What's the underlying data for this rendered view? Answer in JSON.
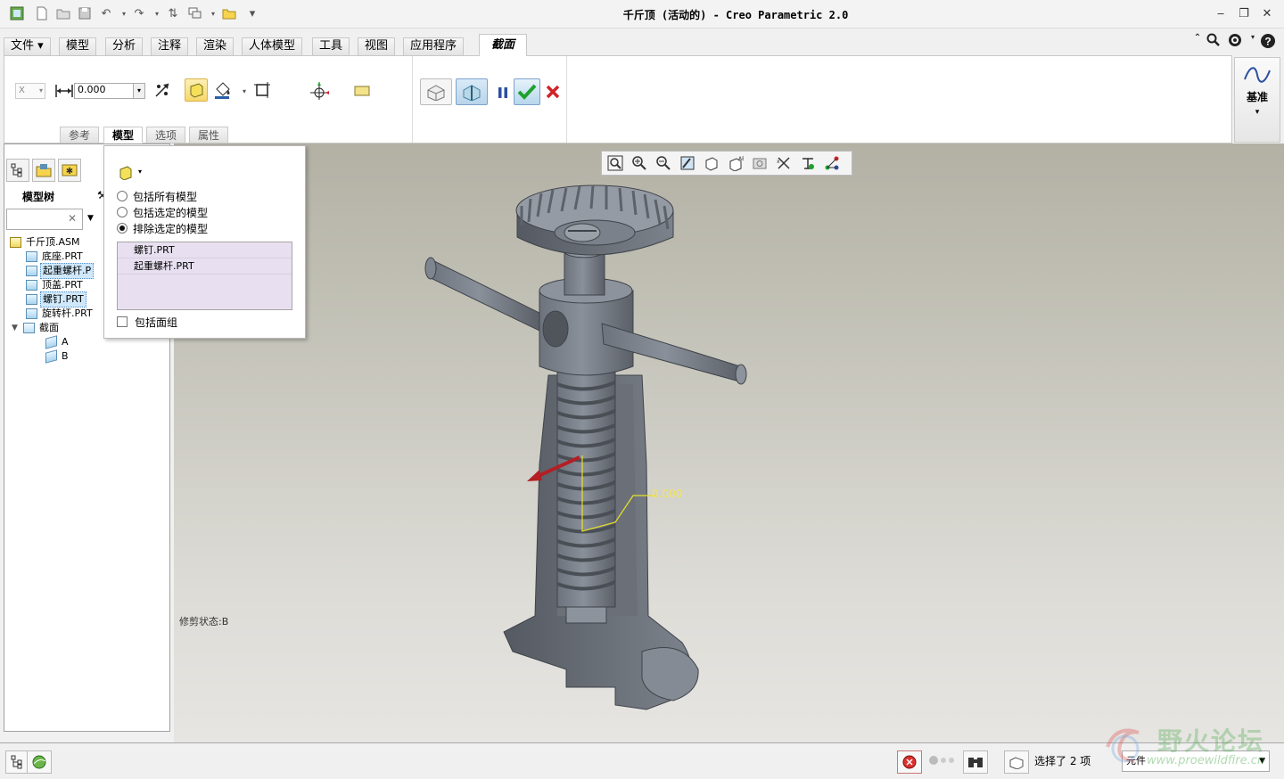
{
  "window": {
    "title": "千斤顶 (活动的) - Creo Parametric 2.0",
    "minimize": "‒",
    "restore": "❐",
    "close": "✕"
  },
  "menu_tabs": [
    {
      "label": "文件 ▾",
      "active": false
    },
    {
      "label": "模型",
      "active": false
    },
    {
      "label": "分析",
      "active": false
    },
    {
      "label": "注释",
      "active": false
    },
    {
      "label": "渲染",
      "active": false
    },
    {
      "label": "人体模型",
      "active": false
    },
    {
      "label": "工具",
      "active": false
    },
    {
      "label": "视图",
      "active": false
    },
    {
      "label": "应用程序",
      "active": false
    },
    {
      "label": "截面",
      "active": true
    }
  ],
  "ribbon": {
    "axis_value": "X",
    "offset_value": "0.000",
    "subtabs": [
      {
        "label": "参考",
        "active": false
      },
      {
        "label": "模型",
        "active": true
      },
      {
        "label": "选项",
        "active": false
      },
      {
        "label": "属性",
        "active": false
      }
    ],
    "datum_label": "基准"
  },
  "model_tree": {
    "title": "模型树",
    "search_placeholder": "",
    "items": [
      {
        "label": "千斤顶.ASM",
        "level": 0,
        "highlight": false
      },
      {
        "label": "底座.PRT",
        "level": 1,
        "highlight": false
      },
      {
        "label": "起重螺杆.P",
        "level": 1,
        "highlight": true
      },
      {
        "label": "顶盖.PRT",
        "level": 1,
        "highlight": false
      },
      {
        "label": "螺钉.PRT",
        "level": 1,
        "highlight": true
      },
      {
        "label": "旋转杆.PRT",
        "level": 1,
        "highlight": false
      },
      {
        "label": "截面",
        "level": 1,
        "highlight": false
      },
      {
        "label": "A",
        "level": 2,
        "highlight": false
      },
      {
        "label": "B",
        "level": 2,
        "highlight": false
      }
    ]
  },
  "model_panel": {
    "options": [
      {
        "label": "包括所有模型",
        "checked": false
      },
      {
        "label": "包括选定的模型",
        "checked": false
      },
      {
        "label": "排除选定的模型",
        "checked": true
      }
    ],
    "selected_models": [
      "螺钉.PRT",
      "起重螺杆.PRT"
    ],
    "include_quilts": "包括面组"
  },
  "viewport": {
    "clip_state": "修剪状态:B",
    "offset_dim": "0.000"
  },
  "status": {
    "selection_count": "选择了 2 项",
    "filter_value": "元件"
  },
  "watermark": {
    "cn": "野火论坛",
    "url": "www.proewildfire.cn"
  },
  "colors": {
    "accent_blue": "#4c8fcf",
    "check_green": "#1fa12f",
    "cancel_red": "#d0232a",
    "model_gray": "#7a7f88"
  }
}
